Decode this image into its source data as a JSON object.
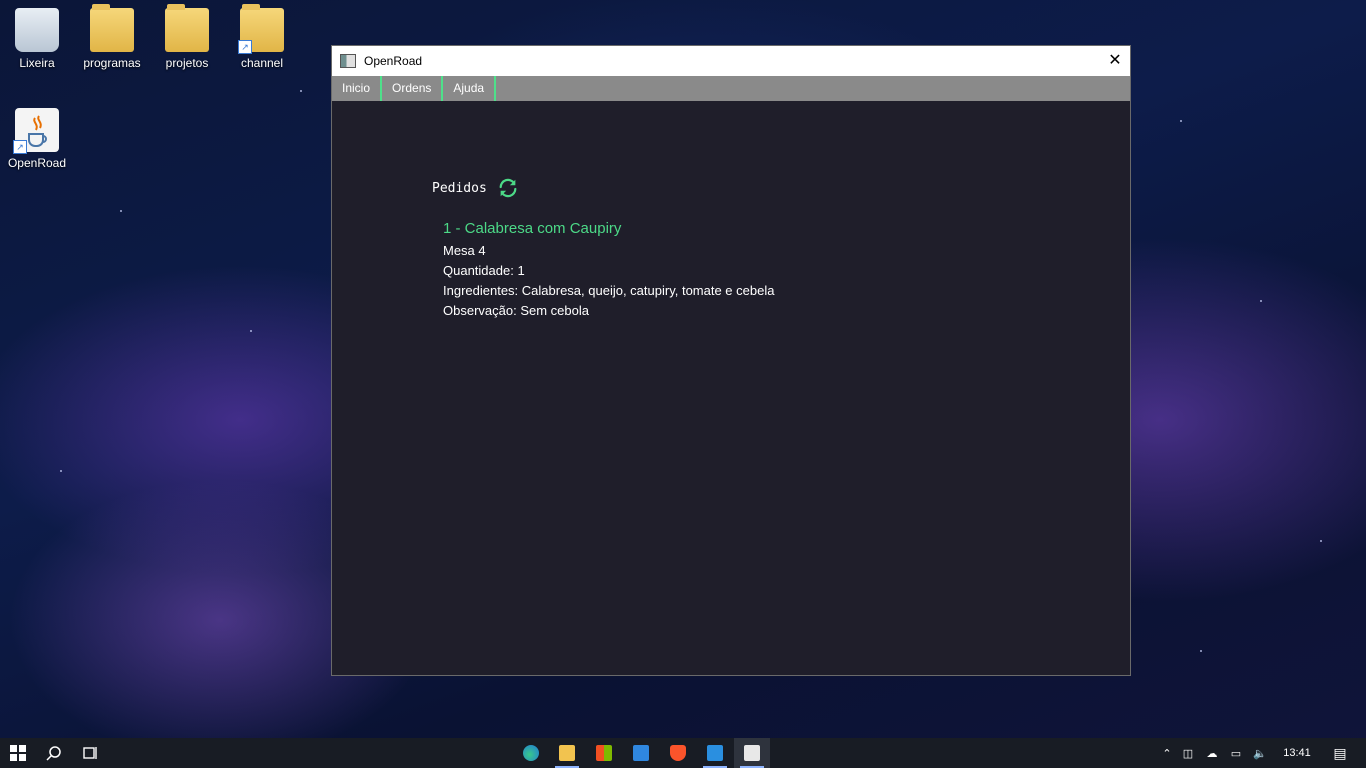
{
  "desktop": {
    "icons": [
      {
        "label": "Lixeira"
      },
      {
        "label": "programas"
      },
      {
        "label": "projetos"
      },
      {
        "label": "channel"
      },
      {
        "label": "OpenRoad"
      }
    ]
  },
  "window": {
    "title": "OpenRoad",
    "close_glyph": "✕",
    "menu": [
      {
        "label": "Inicio"
      },
      {
        "label": "Ordens"
      },
      {
        "label": "Ajuda"
      }
    ],
    "section_title": "Pedidos",
    "order": {
      "title": "1 - Calabresa com Caupiry",
      "table": "Mesa 4",
      "quantity": "Quantidade: 1",
      "ingredients": "Ingredientes: Calabresa, queijo, catupiry, tomate e cebela",
      "note": "Observação: Sem cebola"
    }
  },
  "taskbar": {
    "clock": "13:41"
  },
  "colors": {
    "accent_green": "#4cd987",
    "window_bg": "#1f1e2a",
    "menubar_bg": "#8a8a8a"
  }
}
